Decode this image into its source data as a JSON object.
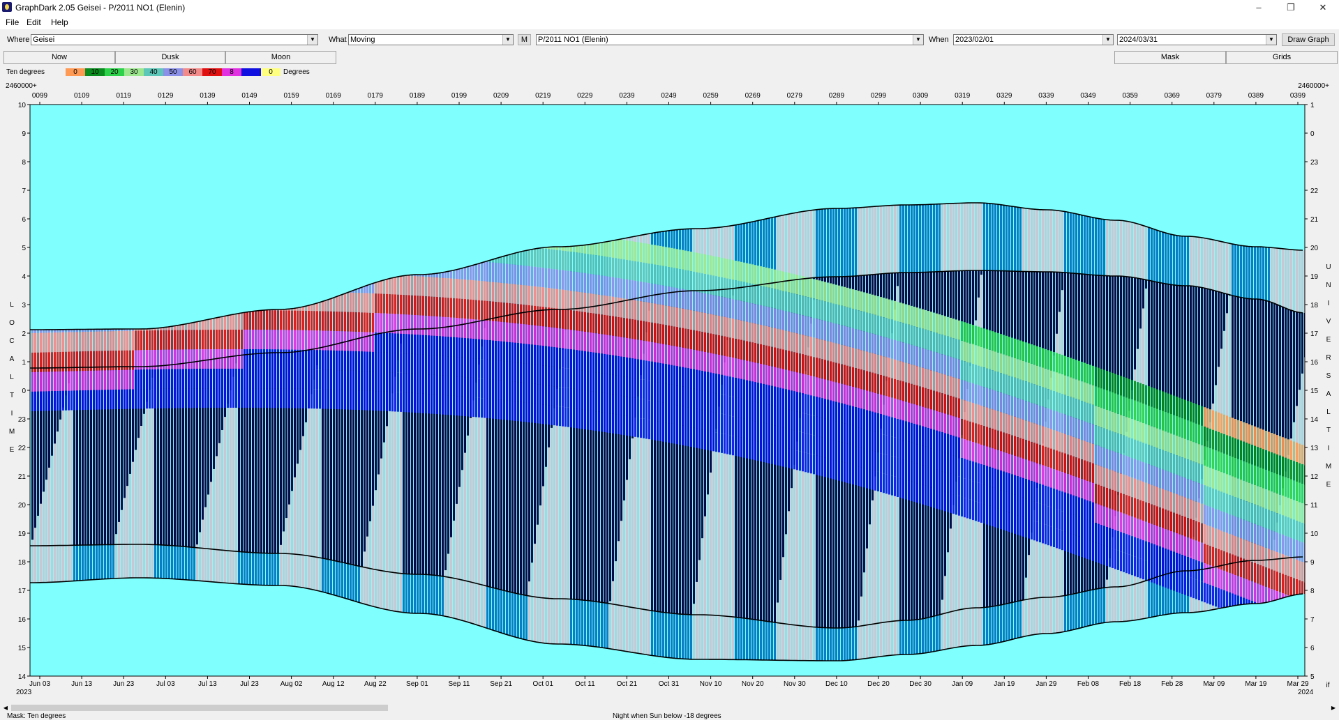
{
  "window": {
    "title": "GraphDark 2.05  Geisei  -  P/2011 NO1 (Elenin)",
    "minimize": "–",
    "maximize": "❐",
    "close": "✕"
  },
  "menu": [
    "File",
    "Edit",
    "Help"
  ],
  "toolbar": {
    "where_label": "Where",
    "where_value": "Geisei",
    "what_label": "What",
    "what_value": "Moving",
    "m_button": "M",
    "object_value": "P/2011 NO1 (Elenin)",
    "when_label": "When",
    "start_date": "2023/02/01",
    "end_date": "2024/03/31",
    "draw_button": "Draw Graph"
  },
  "tabs": {
    "now": "Now",
    "dusk": "Dusk",
    "moon": "Moon",
    "mask": "Mask",
    "grids": "Grids"
  },
  "legend": {
    "title": "Ten degrees",
    "unit": "Degrees",
    "items": [
      {
        "label": "0",
        "color": "#ff9a55"
      },
      {
        "label": "10",
        "color": "#0a8c1e"
      },
      {
        "label": "20",
        "color": "#2ed24a"
      },
      {
        "label": "30",
        "color": "#9de88f"
      },
      {
        "label": "40",
        "color": "#5cc6b8"
      },
      {
        "label": "50",
        "color": "#8a90e8"
      },
      {
        "label": "60",
        "color": "#f28a8a"
      },
      {
        "label": "70",
        "color": "#e01010"
      },
      {
        "label": "8",
        "color": "#e030e0"
      },
      {
        "label": "",
        "color": "#1010e0"
      },
      {
        "label": "0",
        "color": "#ffff80"
      }
    ]
  },
  "chart_data": {
    "type": "heatmap",
    "top_left_label": "2460000+",
    "top_right_label": "2460000+",
    "jd_ticks": [
      "0099",
      "0109",
      "0119",
      "0129",
      "0139",
      "0149",
      "0159",
      "0169",
      "0179",
      "0189",
      "0199",
      "0209",
      "0219",
      "0229",
      "0239",
      "0249",
      "0259",
      "0269",
      "0279",
      "0289",
      "0299",
      "0309",
      "0319",
      "0329",
      "0339",
      "0349",
      "0359",
      "0369",
      "0379",
      "0389",
      "0399"
    ],
    "date_ticks": [
      "Jun 03",
      "Jun 13",
      "Jun 23",
      "Jul 03",
      "Jul 13",
      "Jul 23",
      "Aug 02",
      "Aug 12",
      "Aug 22",
      "Sep 01",
      "Sep 11",
      "Sep 21",
      "Oct 01",
      "Oct 11",
      "Oct 21",
      "Oct 31",
      "Nov 10",
      "Nov 20",
      "Nov 30",
      "Dec 10",
      "Dec 20",
      "Dec 30",
      "Jan 09",
      "Jan 19",
      "Jan 29",
      "Feb 08",
      "Feb 18",
      "Feb 28",
      "Mar 09",
      "Mar 19",
      "Mar 29"
    ],
    "year_left": "2023",
    "year_right": "2024",
    "local_time_ticks": [
      "10",
      "9",
      "8",
      "7",
      "6",
      "5",
      "4",
      "3",
      "2",
      "1",
      "0",
      "23",
      "22",
      "21",
      "20",
      "19",
      "18",
      "17",
      "16",
      "15",
      "14"
    ],
    "universal_time_ticks": [
      "1",
      "0",
      "23",
      "22",
      "21",
      "20",
      "19",
      "18",
      "17",
      "16",
      "15",
      "14",
      "13",
      "12",
      "11",
      "10",
      "9",
      "8",
      "7",
      "6",
      "5"
    ],
    "left_axis_label": "LOCAL TIME",
    "right_axis_label": "UNIVERSAL TIME",
    "corner_label": "if",
    "colors": {
      "daylight": "#80ffff",
      "night": "#0a0a46",
      "moonlit": "#c8c8d4",
      "twilight": "#0a7ec2"
    }
  },
  "status": {
    "left": "Mask:  Ten degrees",
    "center": "Night when Sun below -18 degrees"
  }
}
